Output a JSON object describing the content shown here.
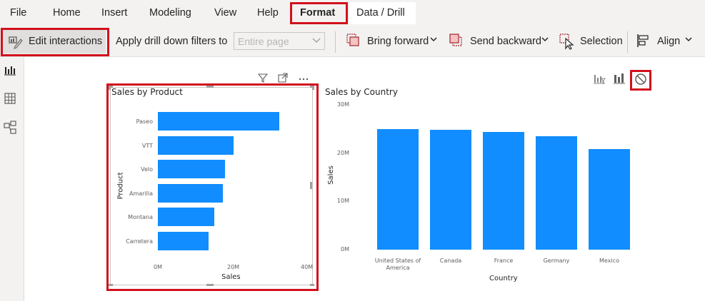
{
  "menu": {
    "items": [
      "File",
      "Home",
      "Insert",
      "Modeling",
      "View",
      "Help",
      "Format",
      "Data / Drill"
    ]
  },
  "ribbon": {
    "edit_interactions": "Edit interactions",
    "apply_drill_label": "Apply drill down filters to",
    "apply_drill_placeholder": "Entire page",
    "bring_forward": "Bring forward",
    "send_backward": "Send backward",
    "selection": "Selection",
    "align": "Align"
  },
  "left_rail": {
    "icons": [
      "report-view-icon",
      "data-view-icon",
      "model-view-icon"
    ]
  },
  "colors": {
    "bar": "#118dff",
    "highlight_box": "#d1111d"
  },
  "chart_data": [
    {
      "type": "bar",
      "orientation": "horizontal",
      "title": "Sales by Product",
      "categories": [
        "Paseo",
        "VTT",
        "Velo",
        "Amarilla",
        "Montana",
        "Carretera"
      ],
      "values": [
        33.0,
        20.5,
        18.2,
        17.7,
        15.4,
        13.8
      ],
      "xlabel": "Sales",
      "ylabel": "Product",
      "xticks": [
        "0M",
        "20M",
        "40M"
      ],
      "xlim": [
        0,
        40
      ],
      "unit": "M"
    },
    {
      "type": "bar",
      "orientation": "vertical",
      "title": "Sales by Country",
      "categories": [
        "United States of America",
        "Canada",
        "France",
        "Germany",
        "Mexico"
      ],
      "values": [
        25.0,
        24.9,
        24.4,
        23.5,
        20.9
      ],
      "xlabel": "Country",
      "ylabel": "Sales",
      "yticks": [
        "0M",
        "10M",
        "20M",
        "30M"
      ],
      "ylim": [
        0,
        30
      ],
      "unit": "M"
    }
  ]
}
